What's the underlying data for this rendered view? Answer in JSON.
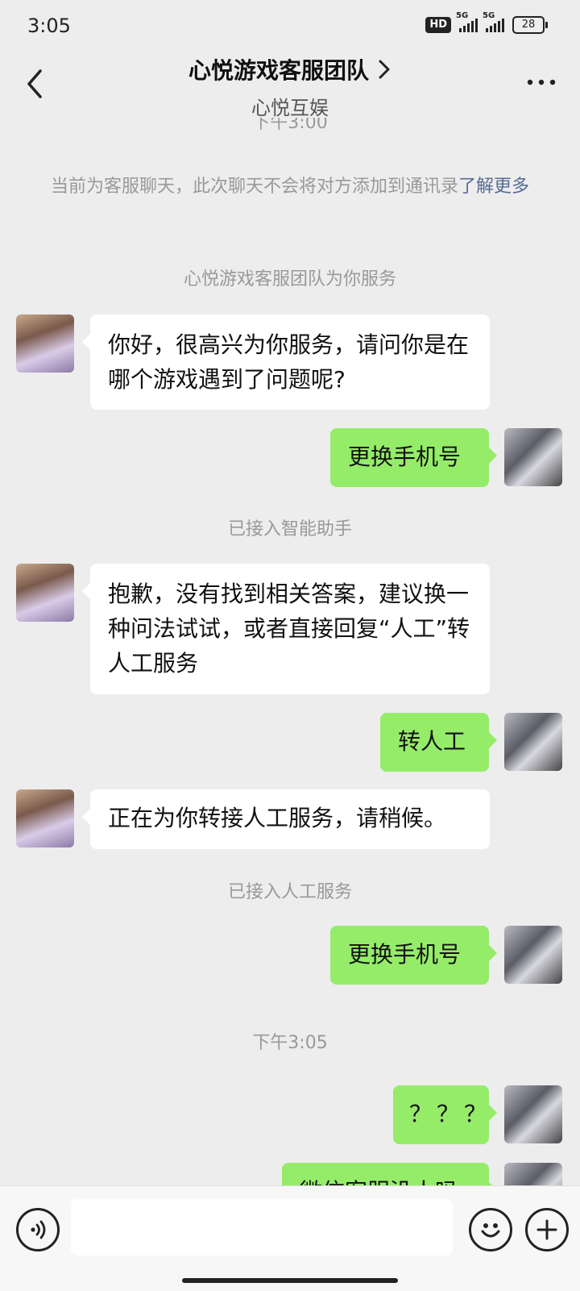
{
  "status_bar": {
    "time": "3:05",
    "hd_label": "HD",
    "network_1": "5G",
    "network_2": "5G",
    "battery": "28"
  },
  "header": {
    "title": "心悦游戏客服团队",
    "subtitle": "心悦互娱",
    "back_icon": "chevron-left-icon",
    "more_icon": "more-dots-icon"
  },
  "chat": {
    "cut_time": "下午3:00",
    "notice_text": "当前为客服聊天，此次聊天不会将对方添加到通讯录",
    "notice_link": "了解更多",
    "service_intro": "心悦游戏客服团队为你服务",
    "msg1": "你好，很高兴为你服务，请问你是在哪个游戏遇到了问题呢?",
    "msg2": "更换手机号",
    "sys_assistant": "已接入智能助手",
    "msg3": "抱歉，没有找到相关答案，建议换一种问法试试，或者直接回复“人工”转人工服务",
    "msg4": "转人工",
    "msg5": "正在为你转接人工服务，请稍候。",
    "sys_human": "已接入人工服务",
    "msg6": "更换手机号",
    "time_2": "下午3:05",
    "msg7": "？？？",
    "msg8_partial": "微信客服没人吗"
  },
  "input_bar": {
    "voice_icon": "voice-icon",
    "emoji_icon": "emoji-icon",
    "plus_icon": "plus-icon",
    "input_value": ""
  },
  "colors": {
    "background": "#ededed",
    "outgoing_bubble": "#95ec69",
    "incoming_bubble": "#ffffff",
    "link": "#576b95"
  }
}
